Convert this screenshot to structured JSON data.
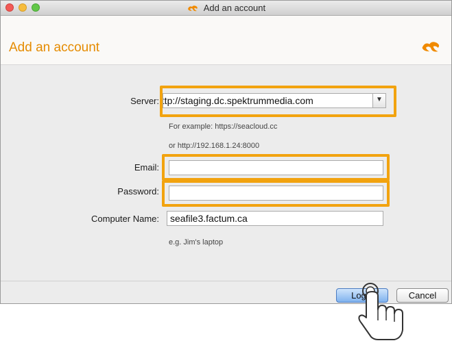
{
  "window": {
    "title": "Add an account"
  },
  "header": {
    "title": "Add an account",
    "logo_icon": "seafile-logo-icon"
  },
  "form": {
    "server": {
      "label": "Server:",
      "value": "http://staging.dc.spektrummedia.com"
    },
    "server_hint_1": "For example: https://seacloud.cc",
    "server_hint_2": "or http://192.168.1.24:8000",
    "email": {
      "label": "Email:",
      "value": ""
    },
    "password": {
      "label": "Password:",
      "value": ""
    },
    "computer_name": {
      "label": "Computer Name:",
      "value": "seafile3.factum.ca",
      "hint": "e.g. Jim's laptop"
    }
  },
  "buttons": {
    "login": "Login",
    "cancel": "Cancel"
  },
  "colors": {
    "accent": "#e58b00",
    "highlight": "#f2a30f"
  }
}
